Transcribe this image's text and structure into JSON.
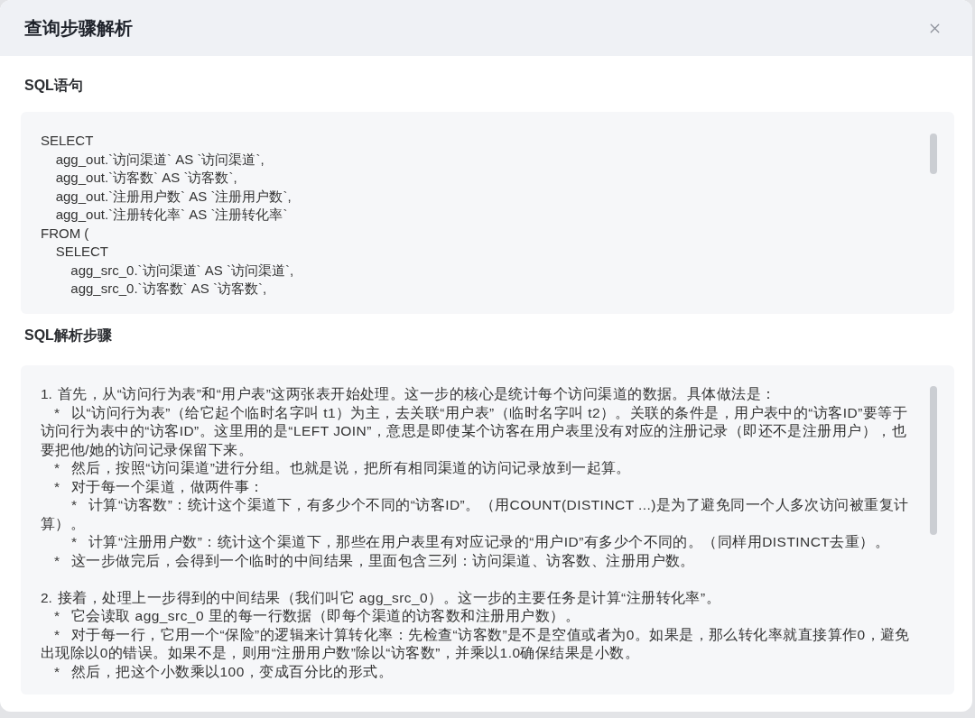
{
  "dialog": {
    "title": "查询步骤解析"
  },
  "sql_section": {
    "heading": "SQL语句",
    "code": "SELECT\n    agg_out.`访问渠道` AS `访问渠道`,\n    agg_out.`访客数` AS `访客数`,\n    agg_out.`注册用户数` AS `注册用户数`,\n    agg_out.`注册转化率` AS `注册转化率`\nFROM (\n    SELECT\n        agg_src_0.`访问渠道` AS `访问渠道`,\n        agg_src_0.`访客数` AS `访客数`,"
  },
  "analysis_section": {
    "heading": "SQL解析步骤",
    "steps": [
      {
        "marker": "1.",
        "text": "首先，从“访问行为表”和“用户表”这两张表开始处理。这一步的核心是统计每个访问渠道的数据。具体做法是：",
        "children": [
          {
            "marker": "*",
            "text": "以“访问行为表”（给它起个临时名字叫 t1）为主，去关联“用户表”（临时名字叫 t2）。关联的条件是，用户表中的“访客ID”要等于访问行为表中的“访客ID”。这里用的是“LEFT JOIN”，意思是即使某个访客在用户表里没有对应的注册记录（即还不是注册用户），也要把他/她的访问记录保留下来。"
          },
          {
            "marker": "*",
            "text": "然后，按照“访问渠道”进行分组。也就是说，把所有相同渠道的访问记录放到一起算。"
          },
          {
            "marker": "*",
            "text": "对于每一个渠道，做两件事：",
            "children": [
              {
                "marker": "*",
                "text": "计算“访客数”：统计这个渠道下，有多少个不同的“访客ID”。（用COUNT(DISTINCT ...)是为了避免同一个人多次访问被重复计算）。"
              },
              {
                "marker": "*",
                "text": "计算“注册用户数”：统计这个渠道下，那些在用户表里有对应记录的“用户ID”有多少个不同的。（同样用DISTINCT去重）。"
              }
            ]
          },
          {
            "marker": "*",
            "text": "这一步做完后，会得到一个临时的中间结果，里面包含三列：访问渠道、访客数、注册用户数。"
          }
        ]
      },
      {
        "marker": "2.",
        "text": "接着，处理上一步得到的中间结果（我们叫它 agg_src_0）。这一步的主要任务是计算“注册转化率”。",
        "children": [
          {
            "marker": "*",
            "text": "它会读取 agg_src_0 里的每一行数据（即每个渠道的访客数和注册用户数）。"
          },
          {
            "marker": "*",
            "text": "对于每一行，它用一个“保险”的逻辑来计算转化率：先检查“访客数”是不是空值或者为0。如果是，那么转化率就直接算作0，避免出现除以0的错误。如果不是，则用“注册用户数”除以“访客数”，并乘以1.0确保结果是小数。"
          },
          {
            "marker": "*",
            "text": "然后，把这个小数乘以100，变成百分比的形式。"
          }
        ]
      }
    ]
  }
}
